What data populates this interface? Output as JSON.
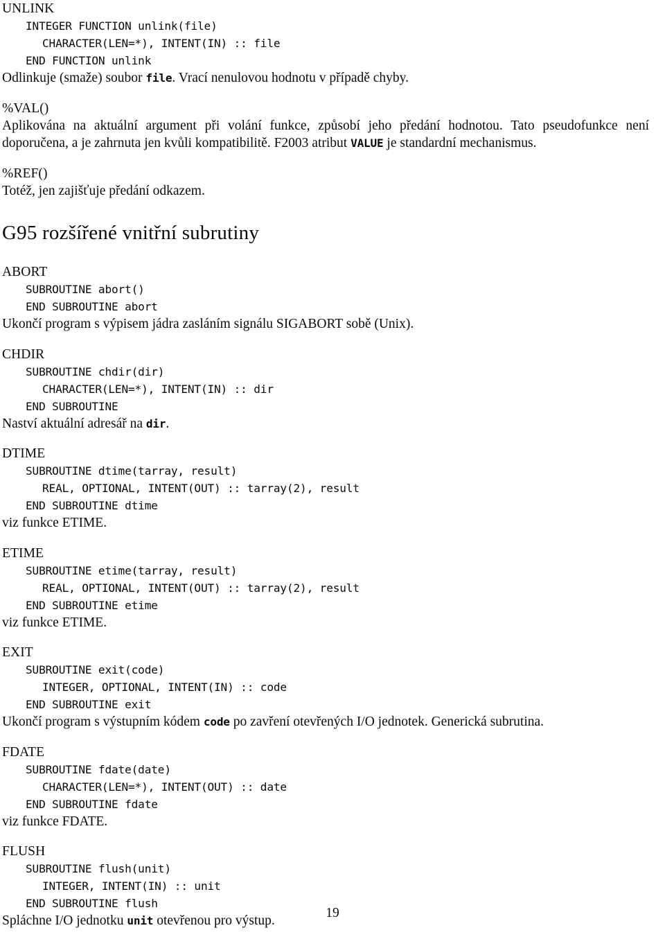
{
  "document": {
    "language": "cs",
    "page_number": "19"
  },
  "entries_before_heading": [
    {
      "name": "UNLINK",
      "code": [
        {
          "indent": 1,
          "text": "INTEGER FUNCTION unlink(file)"
        },
        {
          "indent": 2,
          "text": "CHARACTER(LEN=*), INTENT(IN) :: file"
        },
        {
          "indent": 1,
          "text": "END FUNCTION unlink"
        }
      ],
      "description_parts": [
        {
          "type": "text",
          "text": "Odlinkuje (smaže) soubor "
        },
        {
          "type": "code",
          "text": "file"
        },
        {
          "type": "text",
          "text": ". Vrací nenulovou hodnotu v případě chyby."
        }
      ],
      "description_plain": "Odlinkuje (smaže) soubor file. Vrací nenulovou hodnotu v případě chyby."
    },
    {
      "name": "%VAL()",
      "code": [],
      "description_parts": [
        {
          "type": "text",
          "text": "Aplikována na aktuální argument při volání funkce, způsobí jeho předání hodnotou. Tato pseudofunkce není doporučena, a je zahrnuta jen kvůli kompatibilitě. F2003 atribut "
        },
        {
          "type": "code",
          "text": "VALUE"
        },
        {
          "type": "text",
          "text": " je standardní mechanismus."
        }
      ],
      "description_plain": "Aplikována na aktuální argument při volání funkce, způsobí jeho předání hodnotou. Tato pseudofunkce není doporučena, a je zahrnuta jen kvůli kompatibilitě. F2003 atribut VALUE je standardní mechanismus."
    },
    {
      "name": "%REF()",
      "code": [],
      "description_parts": [
        {
          "type": "text",
          "text": "Totéž, jen zajišťuje předání odkazem."
        }
      ],
      "description_plain": "Totéž, jen zajišťuje předání odkazem."
    }
  ],
  "section": {
    "heading": "G95 rozšířené vnitřní subrutiny"
  },
  "entries_after_heading": [
    {
      "name": "ABORT",
      "code": [
        {
          "indent": 1,
          "text": "SUBROUTINE abort()"
        },
        {
          "indent": 1,
          "text": "END SUBROUTINE abort"
        }
      ],
      "description_parts": [
        {
          "type": "text",
          "text": "Ukončí program s výpisem jádra zasláním signálu SIGABORT sobě (Unix)."
        }
      ],
      "description_plain": "Ukončí program s výpisem jádra zasláním signálu SIGABORT sobě (Unix)."
    },
    {
      "name": "CHDIR",
      "code": [
        {
          "indent": 1,
          "text": "SUBROUTINE chdir(dir)"
        },
        {
          "indent": 2,
          "text": "CHARACTER(LEN=*), INTENT(IN) :: dir"
        },
        {
          "indent": 1,
          "text": "END SUBROUTINE"
        }
      ],
      "description_parts": [
        {
          "type": "text",
          "text": "Naství aktuální adresář na "
        },
        {
          "type": "code",
          "text": "dir"
        },
        {
          "type": "text",
          "text": "."
        }
      ],
      "description_plain": "Naství aktuální adresář na dir."
    },
    {
      "name": "DTIME",
      "code": [
        {
          "indent": 1,
          "text": "SUBROUTINE dtime(tarray, result)"
        },
        {
          "indent": 2,
          "text": "REAL, OPTIONAL, INTENT(OUT) :: tarray(2), result"
        },
        {
          "indent": 1,
          "text": "END SUBROUTINE dtime"
        }
      ],
      "description_parts": [
        {
          "type": "text",
          "text": "viz funkce ETIME."
        }
      ],
      "description_plain": "viz funkce ETIME."
    },
    {
      "name": "ETIME",
      "code": [
        {
          "indent": 1,
          "text": "SUBROUTINE etime(tarray, result)"
        },
        {
          "indent": 2,
          "text": "REAL, OPTIONAL, INTENT(OUT) :: tarray(2), result"
        },
        {
          "indent": 1,
          "text": "END SUBROUTINE etime"
        }
      ],
      "description_parts": [
        {
          "type": "text",
          "text": "viz funkce ETIME."
        }
      ],
      "description_plain": "viz funkce ETIME."
    },
    {
      "name": "EXIT",
      "code": [
        {
          "indent": 1,
          "text": "SUBROUTINE exit(code)"
        },
        {
          "indent": 2,
          "text": "INTEGER, OPTIONAL, INTENT(IN) :: code"
        },
        {
          "indent": 1,
          "text": "END SUBROUTINE exit"
        }
      ],
      "description_parts": [
        {
          "type": "text",
          "text": "Ukončí program s výstupním kódem "
        },
        {
          "type": "code",
          "text": "code"
        },
        {
          "type": "text",
          "text": " po zavření otevřených I/O jednotek. Generická subrutina."
        }
      ],
      "description_plain": "Ukončí program s výstupním kódem code po zavření otevřených I/O jednotek. Generická subrutina."
    },
    {
      "name": "FDATE",
      "code": [
        {
          "indent": 1,
          "text": "SUBROUTINE fdate(date)"
        },
        {
          "indent": 2,
          "text": "CHARACTER(LEN=*), INTENT(OUT) :: date"
        },
        {
          "indent": 1,
          "text": "END SUBROUTINE fdate"
        }
      ],
      "description_parts": [
        {
          "type": "text",
          "text": "viz funkce FDATE."
        }
      ],
      "description_plain": "viz funkce FDATE."
    },
    {
      "name": "FLUSH",
      "code": [
        {
          "indent": 1,
          "text": "SUBROUTINE flush(unit)"
        },
        {
          "indent": 2,
          "text": "INTEGER, INTENT(IN) :: unit"
        },
        {
          "indent": 1,
          "text": "END SUBROUTINE flush"
        }
      ],
      "description_parts": [
        {
          "type": "text",
          "text": "Spláchne I/O jednotku "
        },
        {
          "type": "code",
          "text": "unit"
        },
        {
          "type": "text",
          "text": " otevřenou pro výstup."
        }
      ],
      "description_plain": "Spláchne I/O jednotku unit otevřenou pro výstup."
    }
  ]
}
